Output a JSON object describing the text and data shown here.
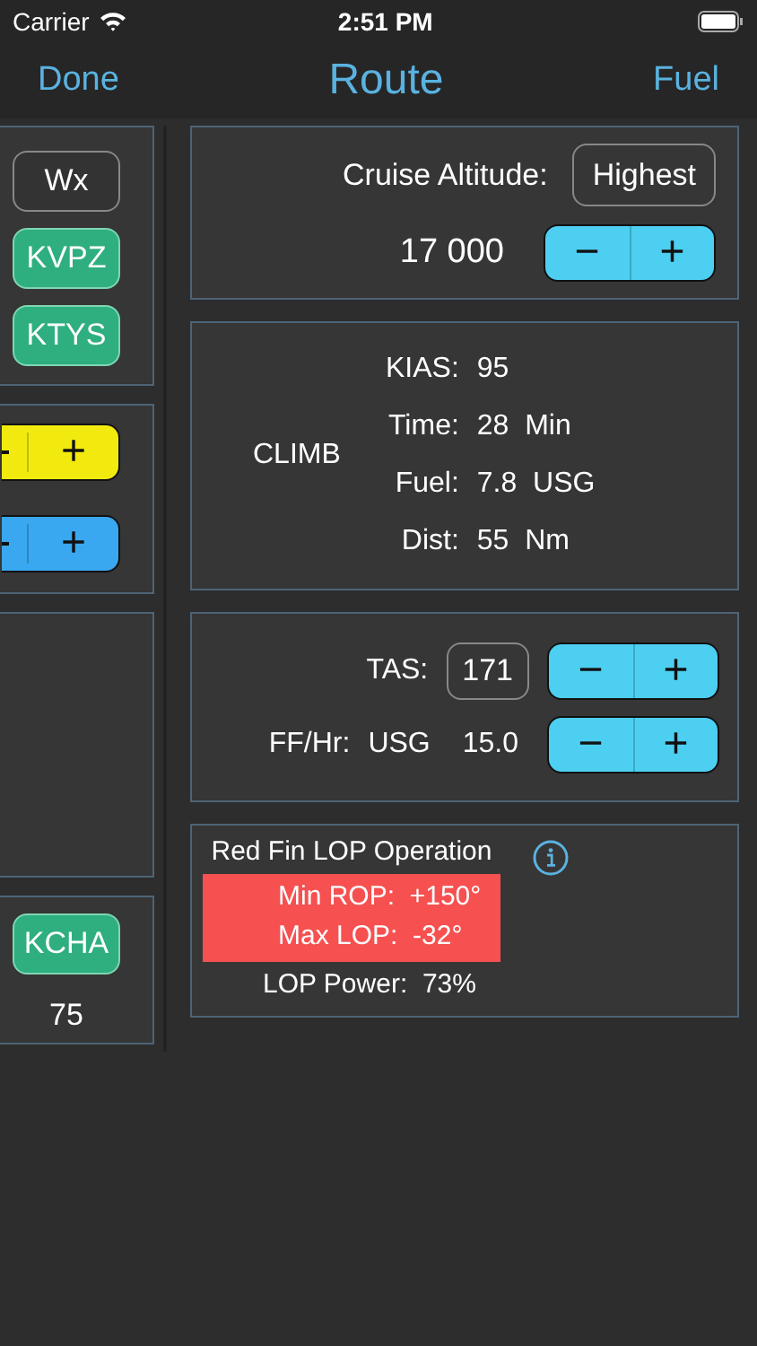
{
  "status_bar": {
    "carrier": "Carrier",
    "time": "2:51 PM"
  },
  "nav": {
    "left": "Done",
    "title": "Route",
    "right": "Fuel"
  },
  "left_panels": [
    {
      "kind": "buttons",
      "buttons": [
        {
          "label": "Wx",
          "kind": "outline"
        },
        {
          "label": "KVPZ",
          "kind": "green"
        },
        {
          "label": "KTYS",
          "kind": "green"
        }
      ]
    },
    {
      "kind": "steppers",
      "steppers": [
        {
          "plus": "+",
          "color": "#f2ea0e"
        },
        {
          "plus": "+",
          "color": "#3aa8f0"
        }
      ]
    },
    {
      "kind": "empty"
    },
    {
      "kind": "airport",
      "button": "KCHA",
      "value": "75"
    }
  ],
  "cruise": {
    "label": "Cruise Altitude:",
    "mode_button": "Highest",
    "altitude": "17 000",
    "stepper": {
      "minus": "−",
      "plus": "+",
      "color": "#4ccff0"
    }
  },
  "climb": {
    "title": "CLIMB",
    "rows": [
      {
        "label": "KIAS:",
        "value": "95"
      },
      {
        "label": "Time:",
        "value": "28",
        "unit": "Min"
      },
      {
        "label": "Fuel:",
        "value": "7.8",
        "unit": "USG"
      },
      {
        "label": "Dist:",
        "value": "55",
        "unit": "Nm"
      }
    ]
  },
  "speed": {
    "tas_label": "TAS:",
    "tas_value": "171",
    "tas_stepper": {
      "minus": "−",
      "plus": "+",
      "color": "#4ccff0"
    },
    "ff_label": "FF/Hr:",
    "ff_unit": "USG",
    "ff_value": "15.0",
    "ff_stepper": {
      "minus": "−",
      "plus": "+",
      "color": "#4ccff0"
    }
  },
  "lop": {
    "title": "Red Fin LOP Operation",
    "rows": [
      {
        "label": "Min ROP:",
        "value": "+150°"
      },
      {
        "label": "Max LOP:",
        "value": "-32°"
      }
    ],
    "power_label": "LOP Power:",
    "power_value": "73%"
  }
}
